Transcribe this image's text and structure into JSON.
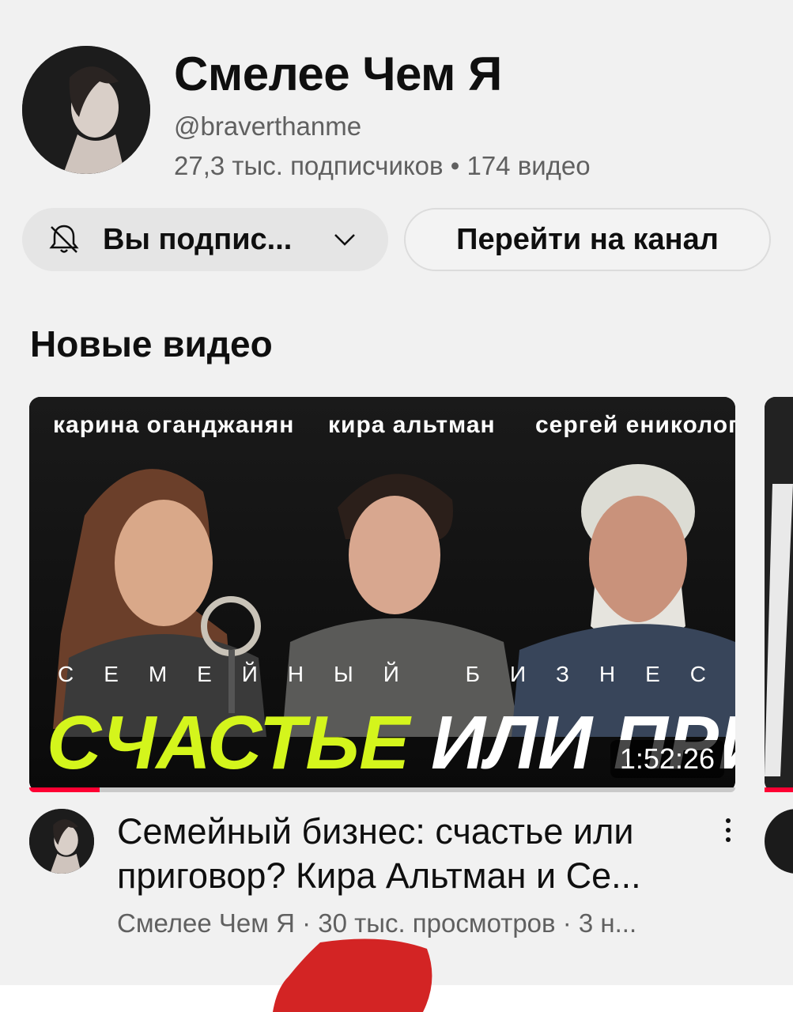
{
  "channel": {
    "name": "Смелее Чем Я",
    "handle": "@braverthanme",
    "stats": "27,3 тыс. подписчиков • 174 видео"
  },
  "buttons": {
    "subscribed_label": "Вы подпис...",
    "go_to_channel_label": "Перейти на канал"
  },
  "section": {
    "title": "Новые видео"
  },
  "video": {
    "thumbnail_names": [
      "карина оганджанян",
      "кира альтман",
      "сергей ениколопов"
    ],
    "thumbnail_subtitle": "С Е М Е Й Н Ы Й   Б И З Н Е С",
    "thumbnail_word_highlight": "СЧАСТЬЕ",
    "thumbnail_word_rest": "ИЛИ ПРИГОВОР?",
    "duration": "1:52:26",
    "watch_progress": 0.1,
    "title": "Семейный бизнес: счастье или приговор? Кира Альтман и Се...",
    "meta": "Смелее Чем Я · 30 тыс. просмотров · 3 н..."
  },
  "colors": {
    "accent_red": "#ff0033",
    "highlight_green": "#d4f51c"
  },
  "icons": {
    "bell": "bell-off-icon",
    "chevron": "chevron-down-icon",
    "menu": "more-vert-icon"
  }
}
